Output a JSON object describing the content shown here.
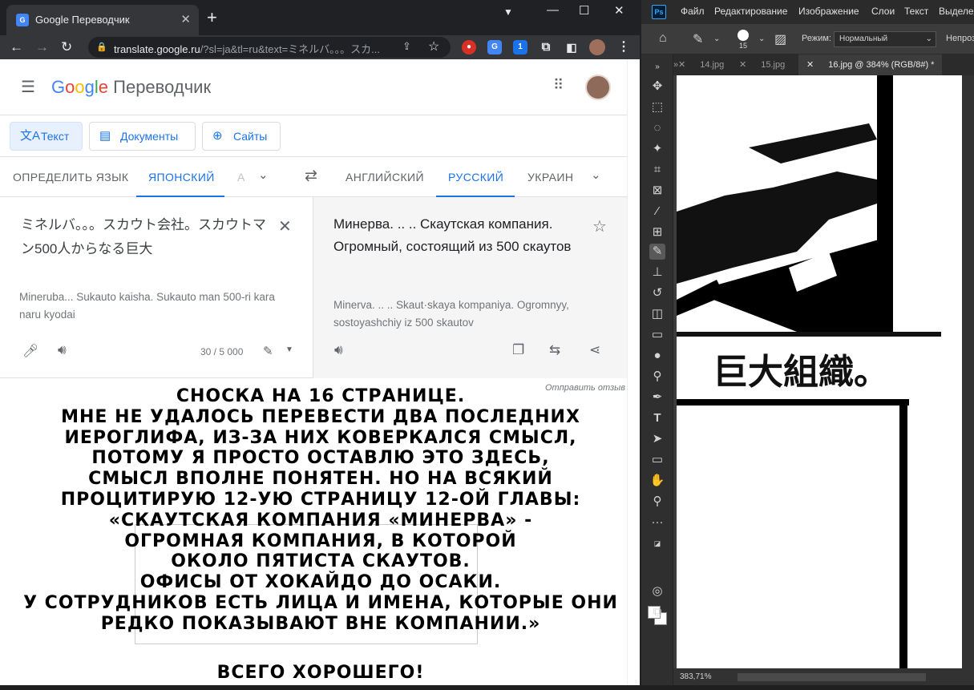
{
  "browser": {
    "tab_title": "Google Переводчик",
    "tab_favicon": "G",
    "url_host": "translate.google.ru",
    "url_rest": "/?sl=ja&tl=ru&text=ミネルバ。。。スカ...",
    "extension_badge": "1"
  },
  "translate": {
    "logo": {
      "g": "G",
      "o1": "o",
      "o2": "o",
      "g2": "g",
      "l": "l",
      "e": "e"
    },
    "product_name": "Переводчик",
    "modes": {
      "text": "Текст",
      "documents": "Документы",
      "sites": "Сайты"
    },
    "source_langs": {
      "detect": "ОПРЕДЕЛИТЬ ЯЗЫК",
      "japanese": "ЯПОНСКИЙ",
      "more": "А"
    },
    "target_langs": {
      "english": "АНГЛИЙСКИЙ",
      "russian": "РУССКИЙ",
      "ukrainian": "УКРАИН"
    },
    "source_text": "ミネルバ。。。スカウト会社。スカウトマン500人からなる巨大",
    "source_translit": "Mineruba... Sukauto kaisha. Sukauto man 500-ri kara naru kyodai",
    "char_count": "30 / 5 000",
    "target_text": "Минерва. .. .. Скаутская компания. Огромный, состоящий из 500 скаутов",
    "target_translit": "Minerva. .. .. Skaut·skaya kompaniya. Ogromnyy, sostoyashchiy iz 500 skautov",
    "feedback": "Отправить отзыв"
  },
  "note": {
    "lines": [
      "СНОСКА НА 16 СТРАНИЦЕ.",
      "МНЕ НЕ УДАЛОСЬ ПЕРЕВЕСТИ ДВА ПОСЛЕДНИХ",
      "ИЕРОГЛИФА, ИЗ-ЗА НИХ КОВЕРКАЛСЯ СМЫСЛ,",
      "ПОТОМУ Я ПРОСТО ОСТАВЛЮ ЭТО ЗДЕСЬ,",
      "СМЫСЛ ВПОЛНЕ ПОНЯТЕН. НО НА ВСЯКИЙ",
      "ПРОЦИТИРУЮ 12-УЮ СТРАНИЦУ 12-ОЙ ГЛАВЫ:",
      "«СКАУТСКАЯ КОМПАНИЯ «МИНЕРВА» -",
      "ОГРОМНАЯ КОМПАНИЯ, В КОТОРОЙ",
      "ОКОЛО ПЯТИСТА СКАУТОВ.",
      "ОФИСЫ ОТ ХОКАЙДО ДО ОСАКИ.",
      "У СОТРУДНИКОВ ЕСТЬ ЛИЦА И ИМЕНА, КОТОРЫЕ ОНИ",
      "РЕДКО ПОКАЗЫВАЮТ ВНЕ КОМПАНИИ.»"
    ],
    "signoff": "ВСЕГО ХОРОШЕГО!"
  },
  "photoshop": {
    "logo": "Ps",
    "menus": [
      "Файл",
      "Редактирование",
      "Изображение",
      "Слои",
      "Текст",
      "Выделе"
    ],
    "brush_size": "15",
    "mode_label": "Режим:",
    "mode_value": "Нормальный",
    "opacity_label": "Непроз",
    "tabs": [
      "14.jpg",
      "15.jpg",
      "16.jpg @ 384% (RGB/8#) *"
    ],
    "zoom": "383,71%",
    "canvas_text": "巨大組織。"
  },
  "colors": {
    "google_blue": "#1a73e8",
    "ps_blue": "#31a8ff",
    "chrome_dark": "#202124",
    "ps_panel": "#3c3c3c"
  }
}
